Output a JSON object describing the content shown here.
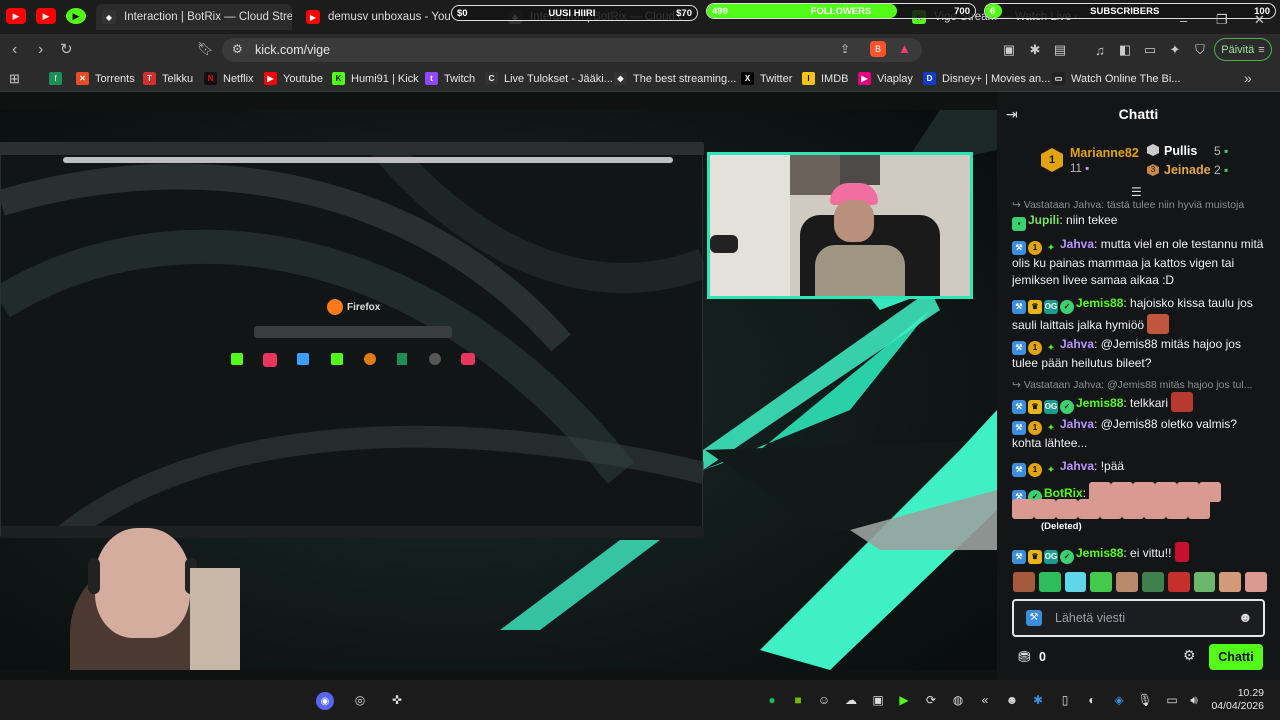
{
  "tabs": [
    {
      "label": "Interaction | BotRix — Cloud Streamin",
      "active": true
    },
    {
      "label": "demusv unboxaus - YouTube"
    },
    {
      "label": "Interaction | BotRix — Cloud Streamin"
    },
    {
      "label": "Vige Stream — Watch Live on"
    }
  ],
  "overlay": {
    "goal1": {
      "left": "$0",
      "title": "UUSI HIIRI",
      "right": "$70",
      "fraction": 0.0
    },
    "goal2": {
      "left": "499",
      "title": "FOLLOWERS",
      "right": "700",
      "fraction": 0.71
    },
    "goal3": {
      "left": "6",
      "title": "SUBSCRIBERS",
      "right": "100",
      "fraction": 0.06
    }
  },
  "address": {
    "url": "kick.com/vige",
    "update_label": "Päivitä"
  },
  "bookmarks": [
    {
      "label": "Torrents",
      "icon": "torrent-icon",
      "color": "#e94b26"
    },
    {
      "label": "Telkku",
      "icon": "telkku-icon",
      "color": "#d32f2f"
    },
    {
      "label": "Netflix",
      "icon": "netflix-icon",
      "color": "#e50914"
    },
    {
      "label": "Youtube",
      "icon": "youtube-icon",
      "color": "#ff0000"
    },
    {
      "label": "Humi91 | Kick",
      "icon": "kick-icon",
      "color": "#53fc18"
    },
    {
      "label": "Twitch",
      "icon": "twitch-icon",
      "color": "#9146ff"
    },
    {
      "label": "Live Tulokset - Jääki...",
      "icon": "live-icon",
      "color": "#444"
    },
    {
      "label": "The best streaming...",
      "icon": "diamond-icon",
      "color": "#333"
    },
    {
      "label": "Twitter",
      "icon": "x-icon",
      "color": "#000"
    },
    {
      "label": "IMDB",
      "icon": "imdb-icon",
      "color": "#f5c518"
    },
    {
      "label": "Viaplay",
      "icon": "viaplay-icon",
      "color": "#e4007d"
    },
    {
      "label": "Disney+ | Movies an...",
      "icon": "disney-icon",
      "color": "#113ccf"
    },
    {
      "label": "Watch Online The Bi...",
      "icon": "tv-icon",
      "color": "#222"
    }
  ],
  "stream": {
    "firefox_label": "Firefox"
  },
  "chat": {
    "title": "Chatti",
    "leaderboard": {
      "first": {
        "rank": "1",
        "name": "Marianne82",
        "count": "11"
      },
      "second": {
        "name": "Pullis",
        "count": "5"
      },
      "third": {
        "rank": "3",
        "name": "Jeinade",
        "count": "2"
      }
    },
    "reply1": "Vastataan Jahva: tästä tulee niin hyviä muistoja",
    "m1": {
      "name": "Jupili",
      "text": "niin tekee"
    },
    "m2": {
      "name": "Jahva",
      "text": "mutta viel en ole testannu mitä olis ku painas mammaa ja kattos vigen tai jemiksen livee samaa aikaa :D"
    },
    "m3": {
      "name": "Jemis88",
      "text": "hajoisko kissa taulu jos sauli laittais jalka hymiöö"
    },
    "m4": {
      "name": "Jahva",
      "text": "@Jemis88 mitäs hajoo jos tulee pään heilutus bileet?"
    },
    "reply2": "Vastataan Jahva: @Jemis88 mitäs hajoo jos tul...",
    "m5": {
      "name": "Jemis88",
      "text": "telkkari"
    },
    "m6": {
      "name": "Jahva",
      "text": "@Jemis88 oletko valmis? kohta lähtee..."
    },
    "m7": {
      "name": "Jahva",
      "text": "!pää"
    },
    "m8": {
      "name": "BotRix",
      "deleted": "(Deleted)"
    },
    "m9": {
      "name": "Jemis88",
      "text": "ei vittu!!"
    },
    "input_placeholder": "Lähetä viesti",
    "points": "0",
    "send_label": "Chatti"
  },
  "taskbar": {
    "time": "10.29",
    "date": "04/04/2026"
  }
}
